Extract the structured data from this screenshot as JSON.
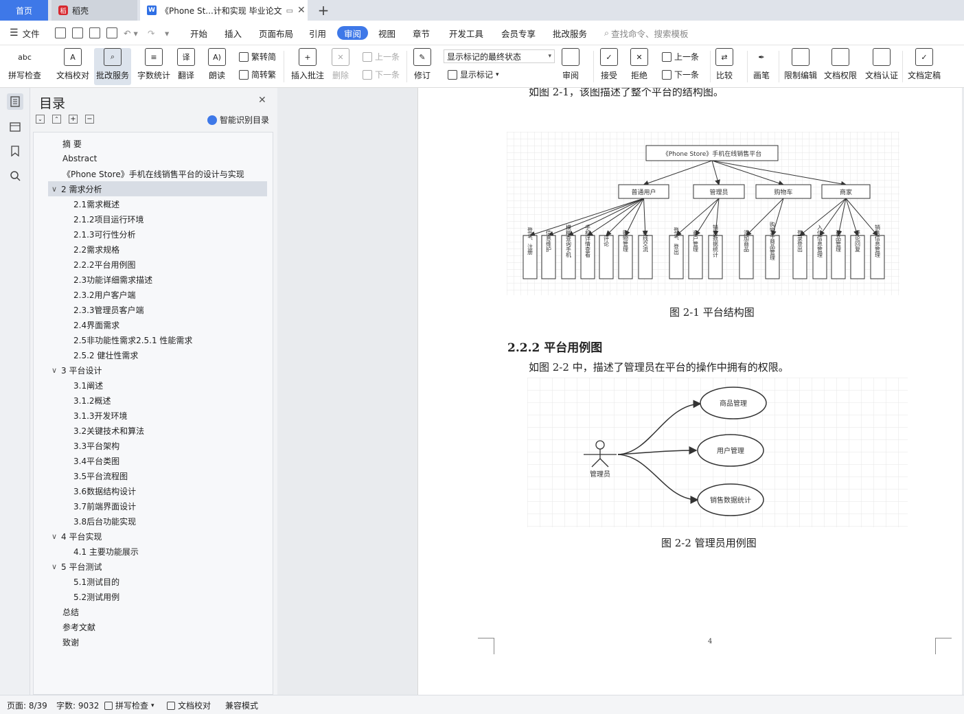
{
  "tabs": {
    "home": "首页",
    "daoke": "稻壳",
    "doc": "《Phone St...计和实现 毕业论文"
  },
  "menu": {
    "file": "文件",
    "items": [
      "开始",
      "插入",
      "页面布局",
      "引用",
      "审阅",
      "视图",
      "章节",
      "开发工具",
      "会员专享",
      "批改服务"
    ],
    "search_placeholder": "查找命令、搜索模板"
  },
  "ribbon": {
    "spell": "拼写检查",
    "proof": "文档校对",
    "correct": "批改服务",
    "count": "字数统计",
    "translate": "翻译",
    "read": "朗读",
    "trad": "繁转简",
    "simp": "简转繁",
    "insert_comment": "插入批注",
    "delete": "删除",
    "prev": "上一条",
    "next": "下一条",
    "revise": "修订",
    "markup_state": "显示标记的最终状态",
    "show_markup": "显示标记",
    "review": "审阅",
    "accept": "接受",
    "reject": "拒绝",
    "prev2": "上一条",
    "next2": "下一条",
    "compare": "比较",
    "pen": "画笔",
    "restrict": "限制编辑",
    "permission": "文档权限",
    "certify": "文档认证",
    "finalize": "文档定稿"
  },
  "toc": {
    "title": "目录",
    "smart": "智能识别目录",
    "items": [
      "摘 要",
      "Abstract",
      "《Phone Store》手机在线销售平台的设计与实现",
      "2 需求分析",
      "2.1需求概述",
      "2.1.2项目运行环境",
      "2.1.3可行性分析",
      "2.2需求规格",
      "2.2.2平台用例图",
      "2.3功能详细需求描述",
      "2.3.2用户客户端",
      "2.3.3管理员客户端",
      "2.4界面需求",
      "2.5非功能性需求2.5.1 性能需求",
      "2.5.2 健壮性需求",
      "3 平台设计",
      "3.1阐述",
      "3.1.2概述",
      "3.1.3开发环境",
      "3.2关键技术和算法",
      "3.3平台架构",
      "3.4平台类图",
      "3.5平台流程图",
      "3.6数据结构设计",
      "3.7前端界面设计",
      "3.8后台功能实现",
      "4 平台实现",
      "4.1 主要功能展示",
      "5 平台测试",
      "5.1测试目的",
      "5.2测试用例",
      "总结",
      "参考文献",
      "致谢"
    ]
  },
  "doc": {
    "top_line": "如图 2-1，该图描述了整个平台的结构图。",
    "fig1_root": "《Phone Store》手机在线销售平台",
    "fig1_branches": [
      "普通用户",
      "管理员",
      "购物车",
      "商家"
    ],
    "fig1_leaves": [
      [
        "登录、注册",
        "信息维护",
        "模糊查询手机",
        "手机详情查看",
        "评论",
        "购物管理",
        "在线交流"
      ],
      [
        "登录、登出",
        "商户管理",
        "销售数据统计"
      ],
      [
        "添加商品",
        "购物车商品管理"
      ],
      [
        "登录登出",
        "入住信息管理",
        "商品管理",
        "评论回复",
        "销售信息管理"
      ]
    ],
    "fig1_caption": "图 2-1 平台结构图",
    "section_heading": "2.2.2 平台用例图",
    "para": "如图 2-2 中，描述了管理员在平台的操作中拥有的权限。",
    "fig2_actor": "管理员",
    "fig2_cases": [
      "商品管理",
      "用户管理",
      "销售数据统计"
    ],
    "fig2_caption": "图 2-2 管理员用例图",
    "page_number": "4"
  },
  "status": {
    "page": "页面: 8/39",
    "words": "字数: 9032",
    "spell": "拼写检查",
    "proof": "文档校对",
    "compat": "兼容模式"
  }
}
